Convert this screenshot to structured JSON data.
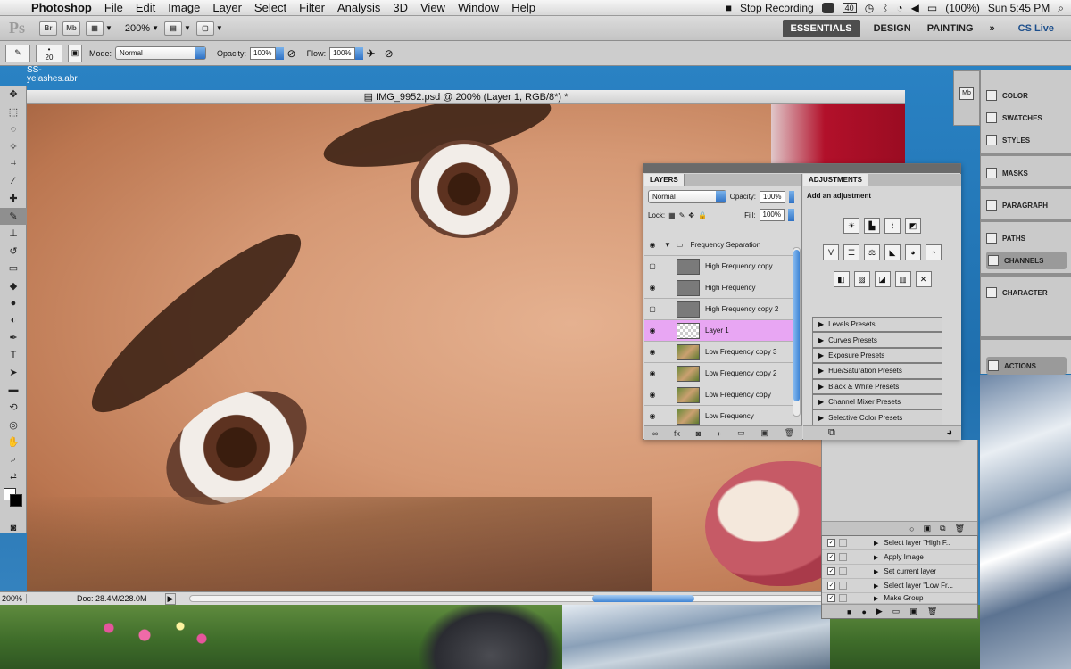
{
  "menubar": {
    "app_name": "Photoshop",
    "items": [
      "File",
      "Edit",
      "Image",
      "Layer",
      "Select",
      "Filter",
      "Analysis",
      "3D",
      "View",
      "Window",
      "Help"
    ],
    "status": {
      "recording": "Stop Recording",
      "battery": "(100%)",
      "clock": "Sun 5:45 PM",
      "badge": "40"
    }
  },
  "appbar": {
    "ps_logo": "Ps",
    "zoom": "200%",
    "workspaces": [
      "ESSENTIALS",
      "DESIGN",
      "PAINTING"
    ],
    "more": "»",
    "cs_live": "CS Live"
  },
  "options": {
    "brush_size": "20",
    "mode_label": "Mode:",
    "mode_value": "Normal",
    "opacity_label": "Opacity:",
    "opacity_value": "100%",
    "flow_label": "Flow:",
    "flow_value": "100%"
  },
  "brush_file": "SS-\nyelashes.abr",
  "document": {
    "title": "IMG_9952.psd @ 200% (Layer 1, RGB/8*) *",
    "zoom": "200%",
    "doc_size": "Doc: 28.4M/228.0M"
  },
  "layers_panel": {
    "tabs": [
      "LAYERS"
    ],
    "blend_mode": "Normal",
    "opacity_label": "Opacity:",
    "opacity_value": "100%",
    "lock_label": "Lock:",
    "fill_label": "Fill:",
    "fill_value": "100%",
    "group_name": "Frequency Separation",
    "layers": [
      {
        "name": "High Frequency copy",
        "visible": false,
        "thumb": "gray"
      },
      {
        "name": "High Frequency",
        "visible": true,
        "thumb": "gray"
      },
      {
        "name": "High Frequency copy 2",
        "visible": false,
        "thumb": "gray"
      },
      {
        "name": "Layer 1",
        "visible": true,
        "thumb": "checker",
        "selected": true
      },
      {
        "name": "Low Frequency copy 3",
        "visible": true,
        "thumb": "photo"
      },
      {
        "name": "Low Frequency copy 2",
        "visible": true,
        "thumb": "photo"
      },
      {
        "name": "Low Frequency copy",
        "visible": true,
        "thumb": "photo"
      },
      {
        "name": "Low Frequency",
        "visible": true,
        "thumb": "photo"
      }
    ]
  },
  "adjustments_panel": {
    "tab": "ADJUSTMENTS",
    "subtitle": "Add an adjustment",
    "presets": [
      "Levels Presets",
      "Curves Presets",
      "Exposure Presets",
      "Hue/Saturation Presets",
      "Black & White Presets",
      "Channel Mixer Presets",
      "Selective Color Presets"
    ]
  },
  "right_dock": {
    "items": [
      "COLOR",
      "SWATCHES",
      "STYLES",
      "MASKS",
      "PARAGRAPH",
      "PATHS",
      "CHANNELS",
      "CHARACTER",
      "ACTIONS"
    ]
  },
  "actions_panel": {
    "items": [
      "Select layer \"High F...",
      "Apply Image",
      "Set current layer",
      "Select layer \"Low Fr...",
      "Make Group"
    ]
  },
  "colors": {
    "selected_layer": "#e8a6f3",
    "accent": "#3f84d4"
  }
}
